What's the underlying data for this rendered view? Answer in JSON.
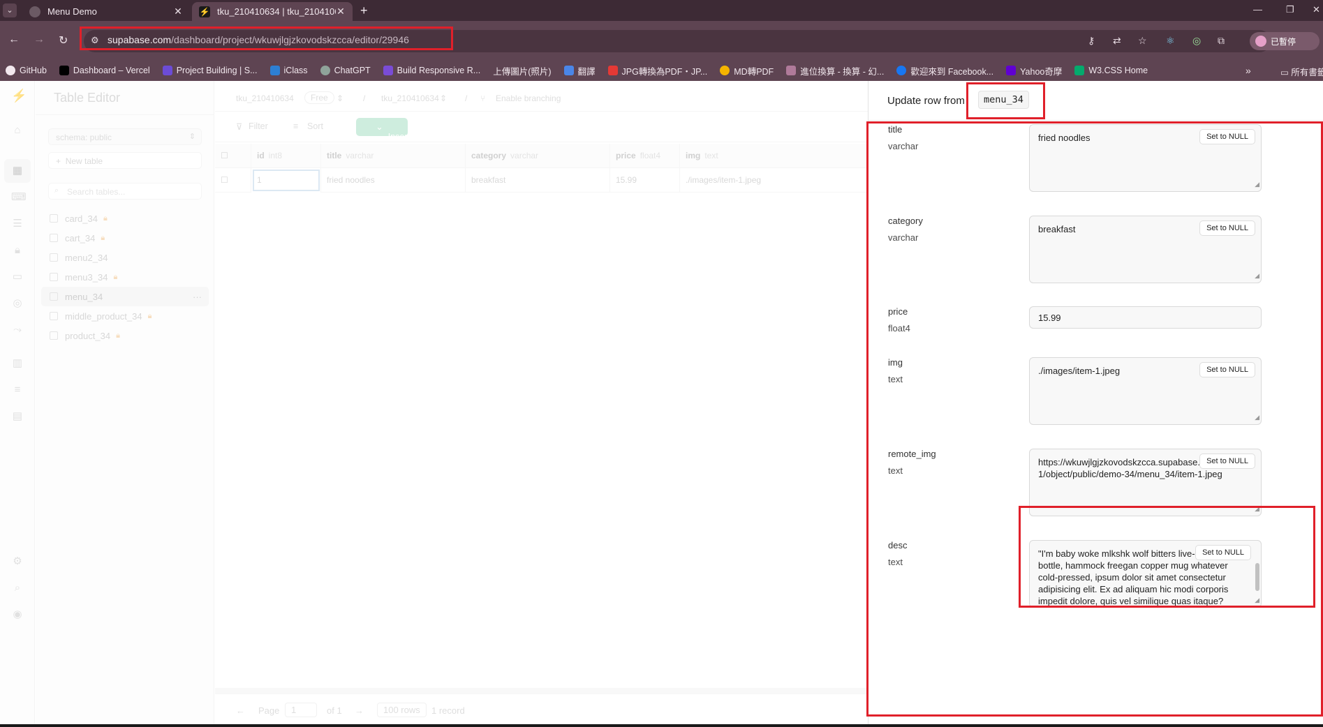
{
  "browser": {
    "tabs": [
      {
        "title": "Menu Demo",
        "active": false
      },
      {
        "title": "tku_210410634 | tku_21041063",
        "active": true
      }
    ],
    "url_host": "supabase.com",
    "url_path": "/dashboard/project/wkuwjlgjzkovodskzcca/editor/29946",
    "profile_label": "已暫停",
    "bookmarks": [
      "GitHub",
      "Dashboard – Vercel",
      "Project Building | S...",
      "iClass",
      "ChatGPT",
      "Build Responsive R...",
      "上傳圖片(照片)",
      "翻譯",
      "JPG轉換為PDF・JP...",
      "MD轉PDF",
      "進位換算 - 換算 - 幻...",
      "歡迎來到 Facebook...",
      "Yahoo奇摩",
      "W3.CSS Home"
    ],
    "bookmarks_folder": "所有書籤"
  },
  "sidebar": {
    "title": "Table Editor",
    "schema": "schema: public",
    "new_table": "New table",
    "search_placeholder": "Search tables...",
    "tables": [
      {
        "name": "card_34",
        "locked": true
      },
      {
        "name": "cart_34",
        "locked": true
      },
      {
        "name": "menu2_34",
        "locked": false
      },
      {
        "name": "menu3_34",
        "locked": true
      },
      {
        "name": "menu_34",
        "locked": false,
        "selected": true
      },
      {
        "name": "middle_product_34",
        "locked": true
      },
      {
        "name": "product_34",
        "locked": true
      }
    ]
  },
  "main": {
    "breadcrumb": {
      "org": "tku_210410634",
      "plan": "Free",
      "project": "tku_210410634",
      "branching": "Enable branching"
    },
    "toolbar": {
      "filter": "Filter",
      "sort": "Sort",
      "insert": "Insert"
    },
    "columns": [
      {
        "name": "id",
        "type": "int8"
      },
      {
        "name": "title",
        "type": "varchar"
      },
      {
        "name": "category",
        "type": "varchar"
      },
      {
        "name": "price",
        "type": "float4"
      },
      {
        "name": "img",
        "type": "text"
      }
    ],
    "rows": [
      {
        "id": "1",
        "title": "fried noodles",
        "category": "breakfast",
        "price": "15.99",
        "img": "./images/item-1.jpeg"
      }
    ],
    "pager": {
      "page_label": "Page",
      "page": "1",
      "of_label": "of 1",
      "rows_per_page": "100 rows",
      "record_count": "1 record"
    }
  },
  "panel": {
    "title_prefix": "Update row from",
    "table_name": "menu_34",
    "null_label": "Set to NULL",
    "fields": [
      {
        "name": "title",
        "type": "varchar",
        "value": "fried noodles"
      },
      {
        "name": "category",
        "type": "varchar",
        "value": "breakfast"
      },
      {
        "name": "price",
        "type": "float4",
        "value": "15.99"
      },
      {
        "name": "img",
        "type": "text",
        "value": "./images/item-1.jpeg"
      },
      {
        "name": "remote_img",
        "type": "text",
        "value": "https://wkuwjlgjzkovodskzcca.supabase.co/storage/v1/object/public/demo-34/menu_34/item-1.jpeg"
      },
      {
        "name": "desc",
        "type": "text",
        "value": "\"I'm baby woke mlkshk wolf bitters live-edge blue bottle, hammock freegan copper mug whatever cold-pressed, ipsum dolor sit amet consectetur adipisicing elit. Ex ad aliquam hic modi corporis impedit dolore, quis vel similique quas itaque? Nesciunt voluptas odio possimus ipsum eveniet quasi repudiandae placeat?\""
      }
    ]
  }
}
